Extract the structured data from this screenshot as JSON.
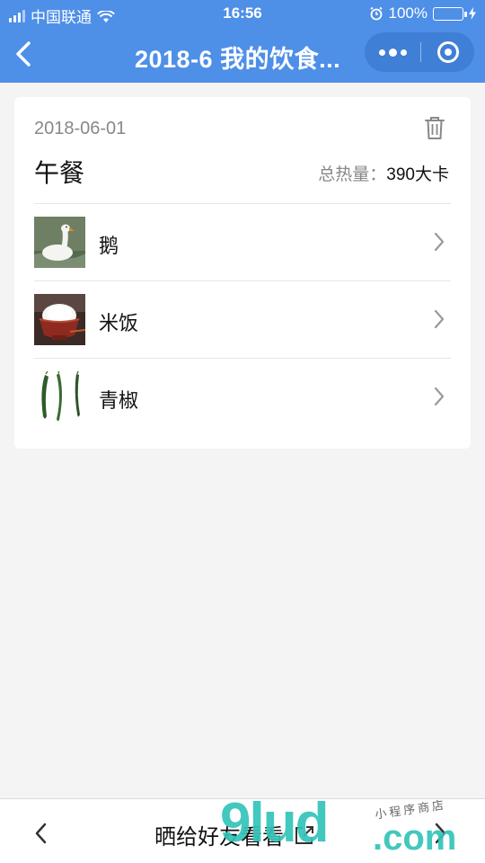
{
  "status": {
    "carrier": "中国联通",
    "time": "16:56",
    "battery": "100%"
  },
  "nav": {
    "title": "2018-6 我的饮食..."
  },
  "card": {
    "date": "2018-06-01",
    "meal": "午餐",
    "total_label": "总热量：",
    "total_value": "390大卡",
    "foods": [
      {
        "name": "鹅"
      },
      {
        "name": "米饭"
      },
      {
        "name": "青椒"
      }
    ]
  },
  "bottom": {
    "share_label": "晒给好友看看"
  },
  "watermark": {
    "big": "9lud",
    "com": ".com",
    "small": "小程序商店"
  },
  "colors": {
    "accent": "#4e8fe8",
    "capsule": "#3f7fd6",
    "watermark": "#33c4b9",
    "background": "#f4f4f4"
  }
}
